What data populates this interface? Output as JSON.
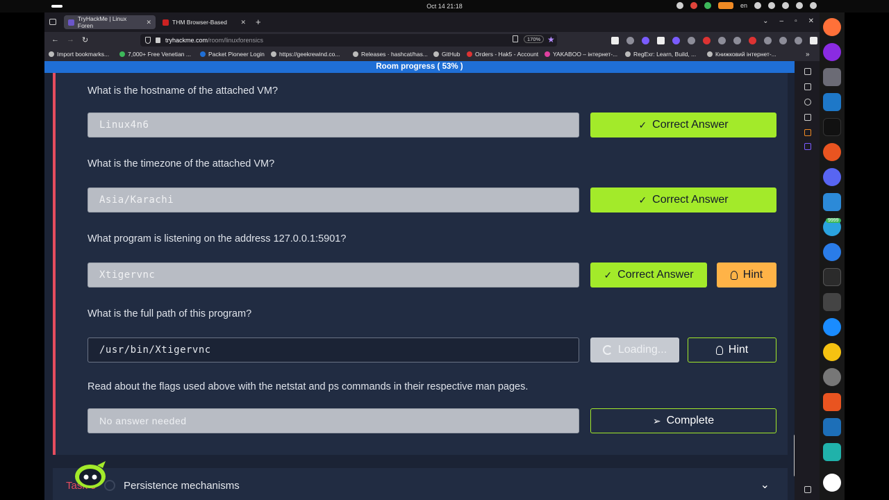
{
  "system_bar": {
    "clock": "Oct 14  21:18",
    "lang": "en"
  },
  "browser": {
    "tabs": [
      {
        "label": "TryHackMe | Linux Foren",
        "active": true
      },
      {
        "label": "THM Browser-Based",
        "active": false
      }
    ],
    "url_host": "tryhackme.com",
    "url_path": "/room/linuxforensics",
    "zoom": "170%",
    "bookmarks": [
      "Import bookmarks...",
      "7,000+ Free Venetian ...",
      "Packet Pioneer Login",
      "https://geekrewind.co...",
      "Releases · hashcat/has...",
      "GitHub",
      "Orders - Hak5 - Account",
      "YAKABOO – інтернет-...",
      "RegExr: Learn, Build, ...",
      "Книжковий інтернет-..."
    ]
  },
  "page": {
    "room_progress": "Room progress ( 53% )",
    "questions": [
      {
        "question": "What is the hostname of the attached VM?",
        "answer": "Linux4n6",
        "status_button": "Correct Answer",
        "hint": null
      },
      {
        "question": "What is the timezone of the attached VM?",
        "answer": "Asia/Karachi",
        "status_button": "Correct Answer",
        "hint": null
      },
      {
        "question": "What program is listening on the address 127.0.0.1:5901?",
        "answer": "Xtigervnc",
        "status_button": "Correct Answer",
        "hint": "Hint"
      },
      {
        "question": "What is the full path of this program?",
        "answer": "/usr/bin/Xtigervnc",
        "status_button": "Loading...",
        "hint": "Hint"
      },
      {
        "question": "Read about the flags used above with the netstat and ps commands in their respective man pages.",
        "answer": "No answer needed",
        "status_button": "Complete",
        "hint": null
      }
    ],
    "next_task": {
      "label": "Task 5",
      "title": "Persistence mechanisms"
    }
  },
  "dock": {
    "telegram_badge": "9999"
  },
  "colors": {
    "accent_green": "#a3ea2a",
    "hint_yellow": "#ffb347",
    "task_red": "#e54d5f",
    "progress_blue": "#1f6fd6",
    "page_bg": "#1b2335",
    "card_bg": "#212c42"
  }
}
